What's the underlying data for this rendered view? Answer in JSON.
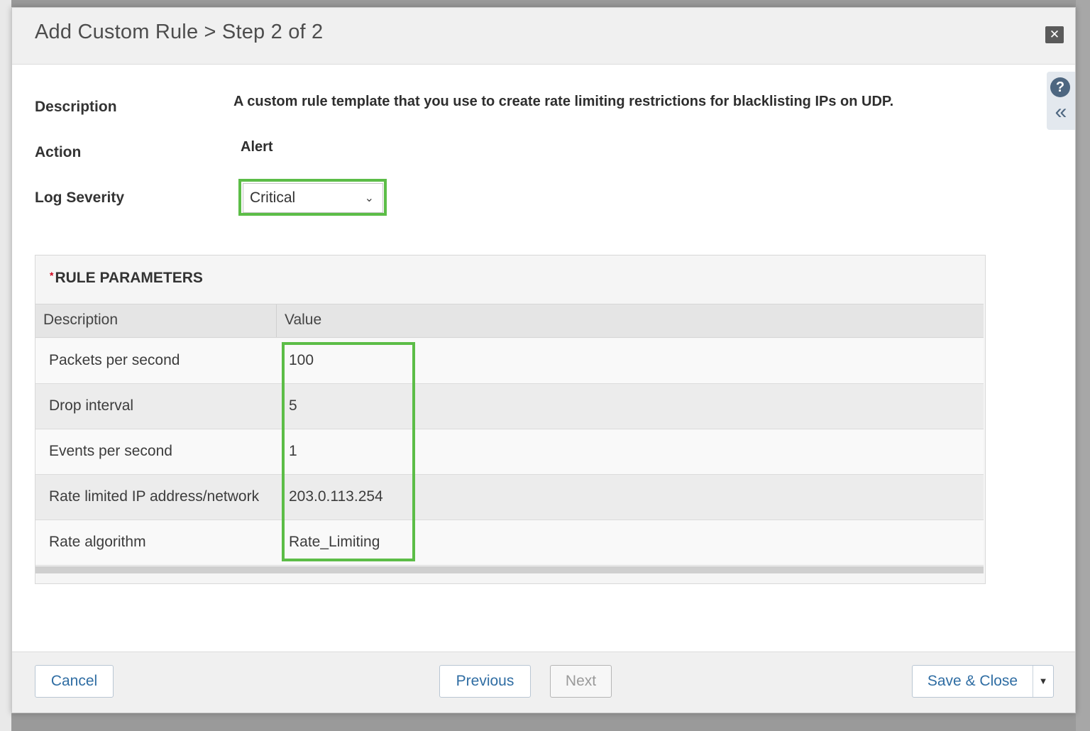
{
  "modal": {
    "title": "Add Custom Rule > Step 2 of 2",
    "close_icon": "close-icon",
    "help_icon": "?",
    "collapse_icon": "«"
  },
  "form": {
    "description_label": "Description",
    "description_value": "A custom rule template that you use to create rate limiting restrictions for blacklisting IPs on UDP.",
    "action_label": "Action",
    "action_value": "Alert",
    "log_severity_label": "Log Severity",
    "log_severity_value": "Critical"
  },
  "params": {
    "title": "RULE PARAMETERS",
    "required_marker": "*",
    "columns": [
      "Description",
      "Value"
    ],
    "rows": [
      {
        "description": "Packets per second",
        "value": "100"
      },
      {
        "description": "Drop interval",
        "value": "5"
      },
      {
        "description": "Events per second",
        "value": "1"
      },
      {
        "description": "Rate limited IP address/network",
        "value": "203.0.113.254"
      },
      {
        "description": "Rate algorithm",
        "value": "Rate_Limiting"
      }
    ]
  },
  "footer": {
    "cancel_label": "Cancel",
    "previous_label": "Previous",
    "next_label": "Next",
    "save_close_label": "Save & Close"
  },
  "colors": {
    "highlight": "#5cbd47",
    "link_blue": "#2f6da3",
    "required_red": "#d0021b"
  }
}
